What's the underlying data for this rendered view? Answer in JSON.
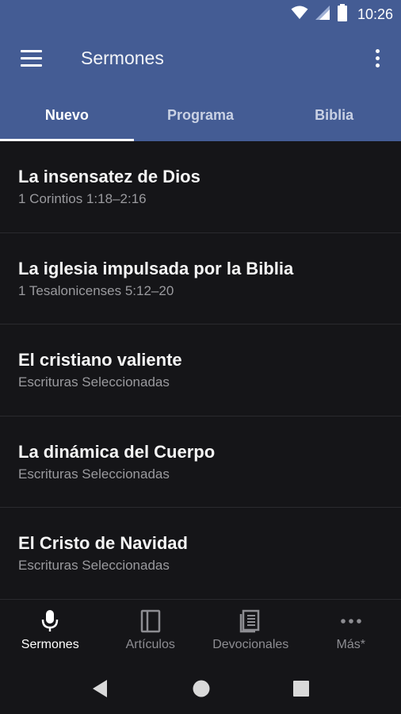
{
  "status_bar": {
    "time": "10:26"
  },
  "app_bar": {
    "title": "Sermones"
  },
  "tabs": [
    {
      "label": "Nuevo",
      "active": true
    },
    {
      "label": "Programa",
      "active": false
    },
    {
      "label": "Biblia",
      "active": false
    }
  ],
  "sermons": [
    {
      "title": "La insensatez de Dios",
      "reference": "1 Corintios 1:18–2:16"
    },
    {
      "title": "La iglesia impulsada por la Biblia",
      "reference": "1 Tesalonicenses 5:12–20"
    },
    {
      "title": "El cristiano valiente",
      "reference": "Escrituras Seleccionadas"
    },
    {
      "title": "La dinámica del Cuerpo",
      "reference": "Escrituras Seleccionadas"
    },
    {
      "title": "El Cristo de Navidad",
      "reference": "Escrituras Seleccionadas"
    }
  ],
  "bottom_nav": [
    {
      "label": "Sermones",
      "icon": "microphone-icon",
      "active": true
    },
    {
      "label": "Artículos",
      "icon": "book-icon",
      "active": false
    },
    {
      "label": "Devocionales",
      "icon": "devotional-book-icon",
      "active": false
    },
    {
      "label": "Más*",
      "icon": "more-horiz-icon",
      "active": false
    }
  ],
  "colors": {
    "app_bar": "#445c94",
    "background": "#151518",
    "active_text": "#ffffff",
    "inactive_text": "#8d8d92"
  }
}
